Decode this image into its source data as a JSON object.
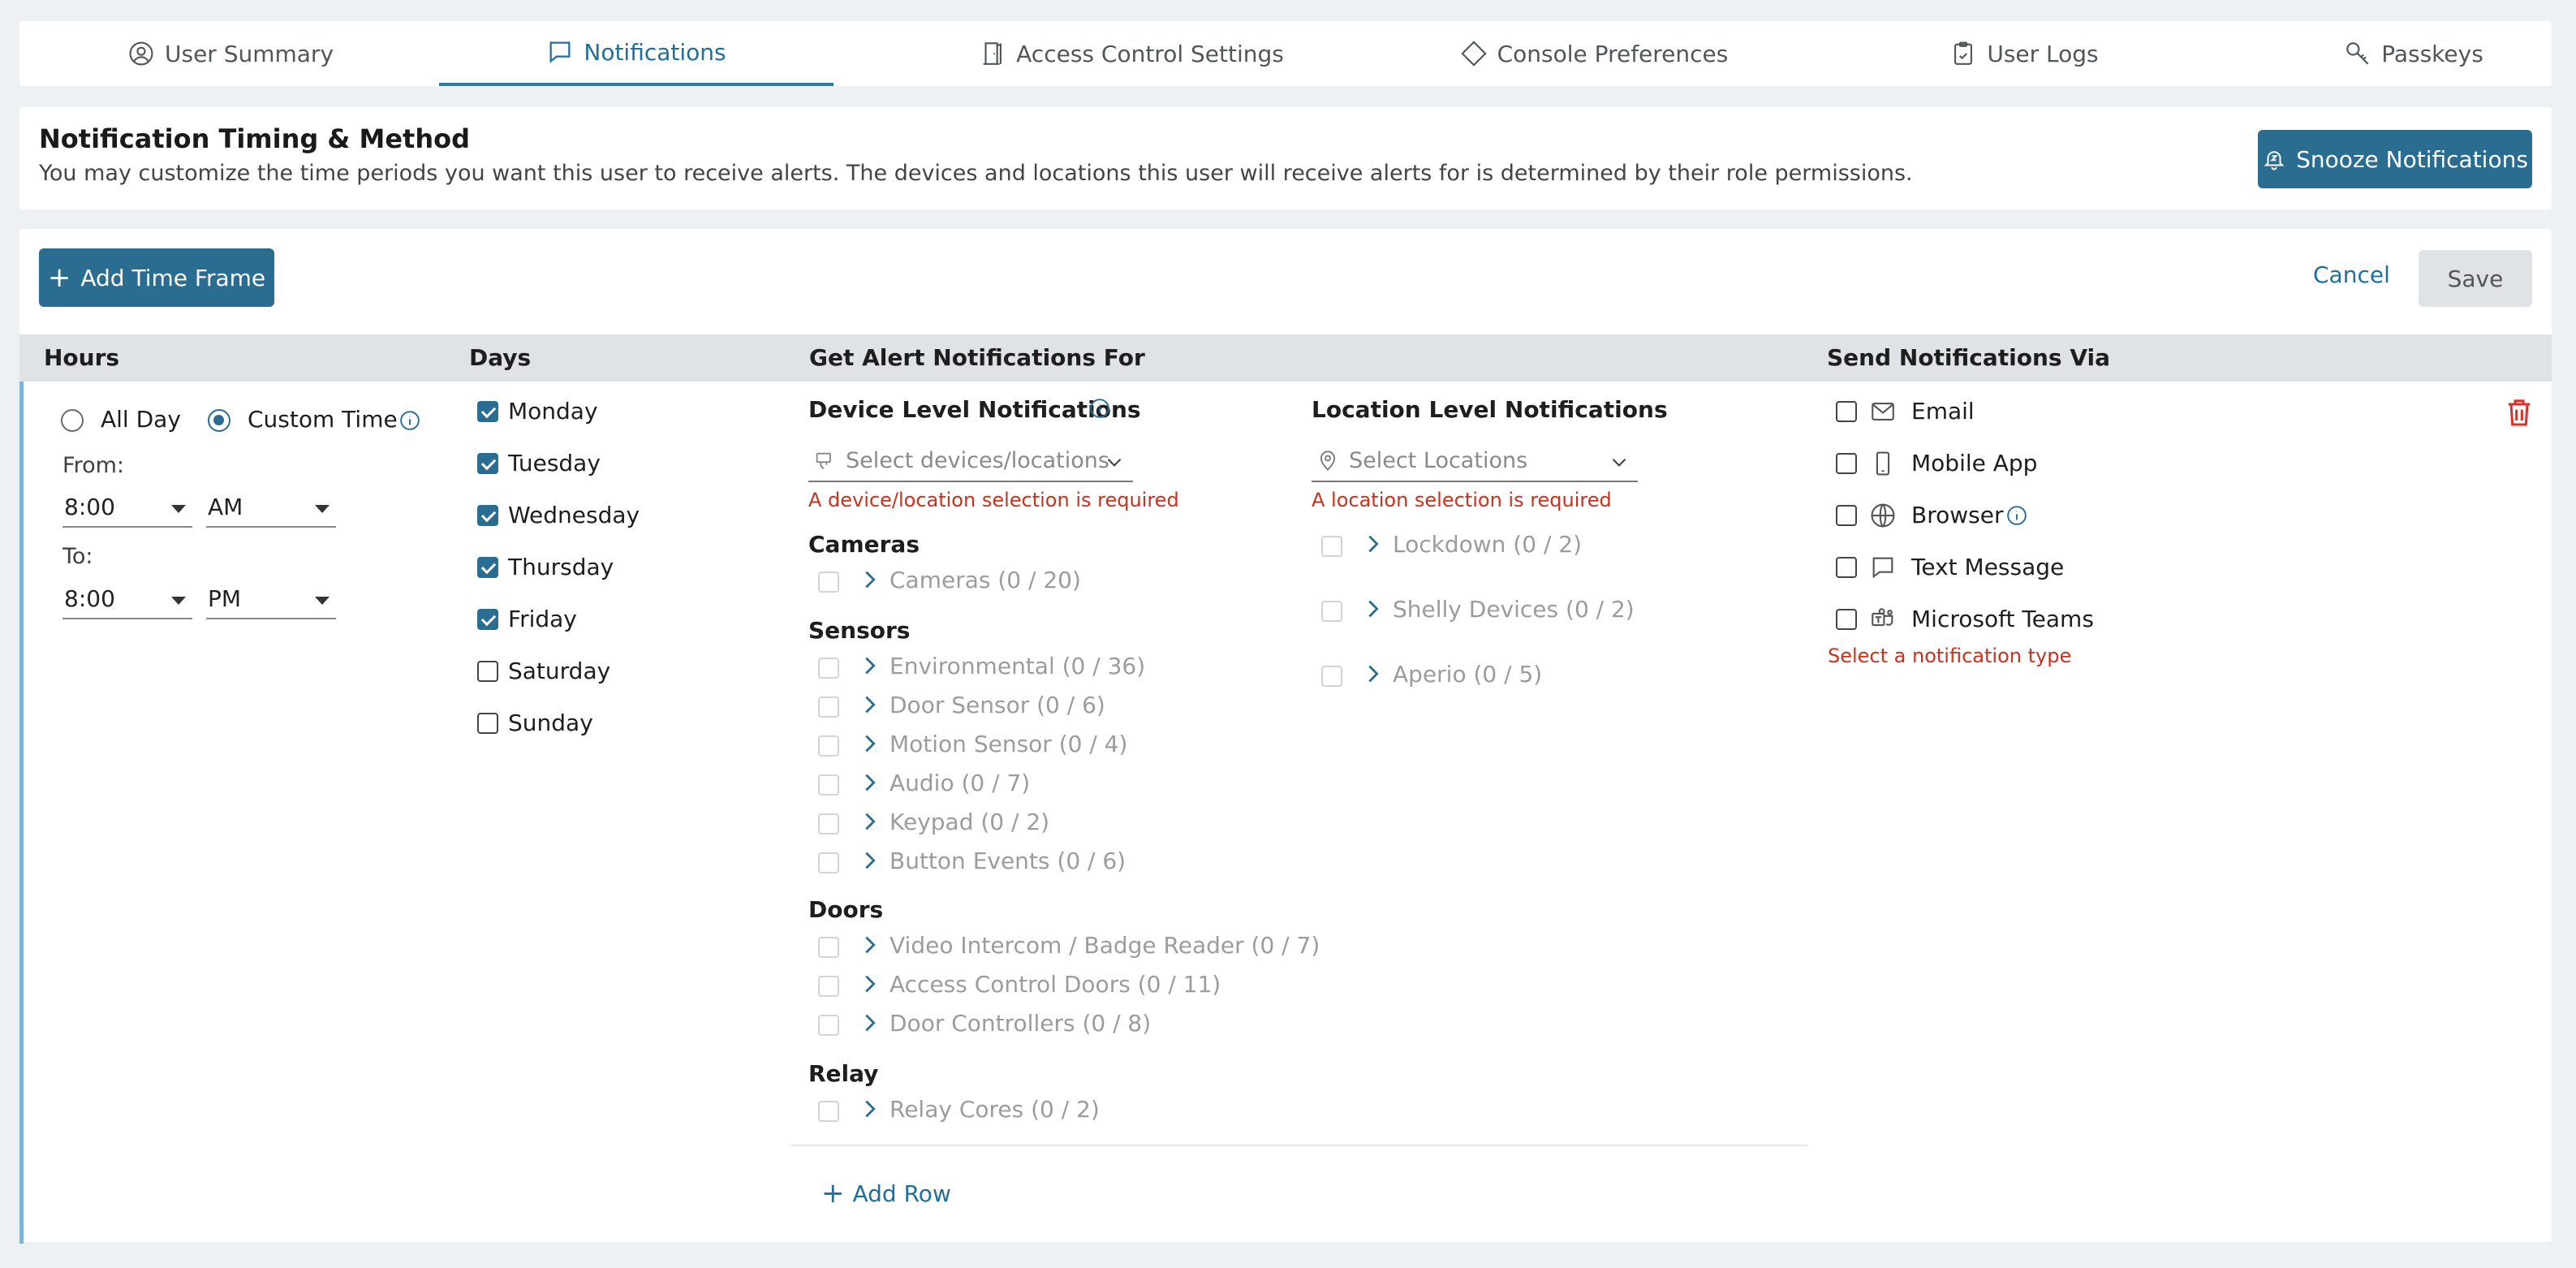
{
  "tabs": [
    {
      "label": "User Summary",
      "icon": "user-circle-icon"
    },
    {
      "label": "Notifications",
      "icon": "chat-bubble-icon",
      "active": true
    },
    {
      "label": "Access Control Settings",
      "icon": "door-icon"
    },
    {
      "label": "Console Preferences",
      "icon": "diamond-icon"
    },
    {
      "label": "User Logs",
      "icon": "clipboard-icon"
    },
    {
      "label": "Passkeys",
      "icon": "key-icon"
    }
  ],
  "header": {
    "title": "Notification Timing & Method",
    "description": "You may customize the time periods you want this user to receive alerts. The devices and locations this user will receive alerts for is determined by their role permissions.",
    "snooze_label": "Snooze Notifications"
  },
  "toolbar": {
    "add_time_frame": "Add Time Frame",
    "cancel": "Cancel",
    "save": "Save"
  },
  "columns": {
    "hours": "Hours",
    "days": "Days",
    "alerts": "Get Alert Notifications For",
    "send": "Send Notifications Via"
  },
  "hours": {
    "all_day": "All Day",
    "custom_time": "Custom Time",
    "selected": "Custom Time",
    "from_label": "From:",
    "from_time": "8:00",
    "from_ampm": "AM",
    "to_label": "To:",
    "to_time": "8:00",
    "to_ampm": "PM"
  },
  "days": [
    {
      "label": "Monday",
      "checked": true
    },
    {
      "label": "Tuesday",
      "checked": true
    },
    {
      "label": "Wednesday",
      "checked": true
    },
    {
      "label": "Thursday",
      "checked": true
    },
    {
      "label": "Friday",
      "checked": true
    },
    {
      "label": "Saturday",
      "checked": false
    },
    {
      "label": "Sunday",
      "checked": false
    }
  ],
  "device_level": {
    "title": "Device Level Notifications",
    "placeholder": "Select devices/locations",
    "error": "A device/location selection is required",
    "groups": [
      {
        "title": "Cameras",
        "items": [
          "Cameras (0 / 20)"
        ]
      },
      {
        "title": "Sensors",
        "items": [
          "Environmental (0 / 36)",
          "Door Sensor (0 / 6)",
          "Motion Sensor (0 / 4)",
          "Audio (0 / 7)",
          "Keypad (0 / 2)",
          "Button Events (0 / 6)"
        ]
      },
      {
        "title": "Doors",
        "items": [
          "Video Intercom / Badge Reader (0 / 7)",
          "Access Control Doors (0 / 11)",
          "Door Controllers (0 / 8)"
        ]
      },
      {
        "title": "Relay",
        "items": [
          "Relay Cores (0 / 2)"
        ]
      }
    ]
  },
  "location_level": {
    "title": "Location Level Notifications",
    "placeholder": "Select Locations",
    "error": "A location selection is required",
    "items": [
      "Lockdown (0 / 2)",
      "Shelly Devices (0 / 2)",
      "Aperio (0 / 5)"
    ]
  },
  "add_row": "Add Row",
  "send_via": {
    "items": [
      {
        "label": "Email",
        "icon": "envelope-icon"
      },
      {
        "label": "Mobile App",
        "icon": "mobile-phone-icon"
      },
      {
        "label": "Browser",
        "icon": "globe-icon"
      },
      {
        "label": "Text Message",
        "icon": "message-bubble-icon"
      },
      {
        "label": "Microsoft Teams",
        "icon": "teams-icon"
      }
    ],
    "error": "Select a notification type"
  },
  "colors": {
    "accent": "#2a6d90",
    "error": "#c8321e",
    "delete": "#d6312b"
  }
}
